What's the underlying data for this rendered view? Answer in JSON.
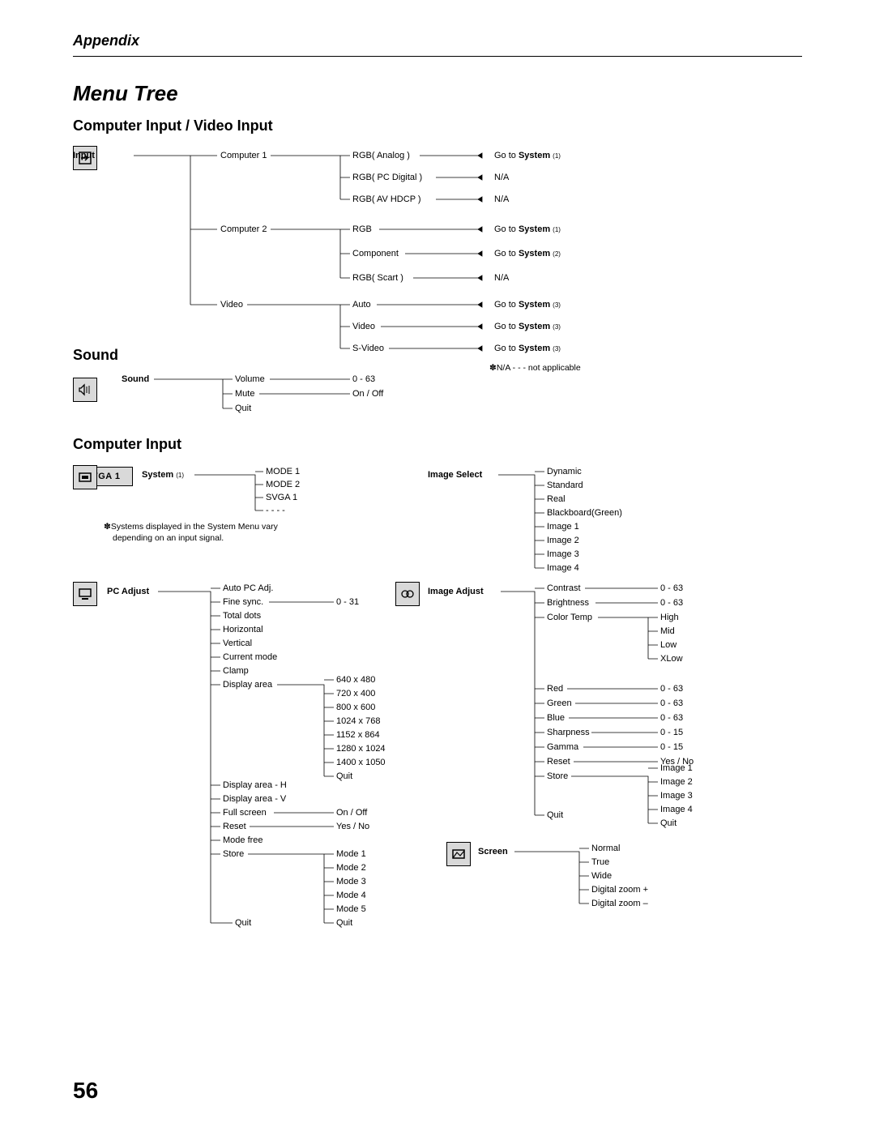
{
  "appendix": "Appendix",
  "title": "Menu Tree",
  "page_number": "56",
  "section_computer_video": "Computer Input / Video Input",
  "section_sound": "Sound",
  "section_computer_input": "Computer Input",
  "input": {
    "label": "Input",
    "computer1": {
      "label": "Computer 1",
      "opts": [
        {
          "name": "RGB( Analog )",
          "to": "Go to ",
          "sys": "System",
          "sysn": "(1)"
        },
        {
          "name": "RGB( PC Digital )",
          "to": "N/A"
        },
        {
          "name": "RGB( AV HDCP )",
          "to": "N/A"
        }
      ]
    },
    "computer2": {
      "label": "Computer 2",
      "opts": [
        {
          "name": "RGB",
          "to": "Go to ",
          "sys": "System",
          "sysn": "(1)"
        },
        {
          "name": "Component",
          "to": "Go to ",
          "sys": "System",
          "sysn": "(2)"
        },
        {
          "name": "RGB( Scart )",
          "to": "N/A"
        }
      ]
    },
    "video": {
      "label": "Video",
      "opts": [
        {
          "name": "Auto",
          "to": "Go to ",
          "sys": "System",
          "sysn": "(3)"
        },
        {
          "name": "Video",
          "to": "Go to ",
          "sys": "System",
          "sysn": "(3)"
        },
        {
          "name": "S-Video",
          "to": "Go to ",
          "sys": "System",
          "sysn": "(3)"
        }
      ]
    },
    "na_note_prefix": "✽",
    "na_note": "N/A - - - not applicable"
  },
  "sound": {
    "label": "Sound",
    "items": [
      {
        "name": "Volume",
        "val": "0 - 63"
      },
      {
        "name": "Mute",
        "val": "On / Off"
      },
      {
        "name": "Quit"
      }
    ]
  },
  "system": {
    "label": "System",
    "num": "(1)",
    "svga": "SVGA 1",
    "items": [
      "MODE 1",
      "MODE 2",
      "SVGA 1",
      "- - - -"
    ],
    "note_prefix": "✽",
    "note_line1": "Systems displayed in the System Menu vary",
    "note_line2": "depending on an input signal."
  },
  "image_select": {
    "label": "Image Select",
    "items": [
      "Dynamic",
      "Standard",
      "Real",
      "Blackboard(Green)",
      "Image 1",
      "Image 2",
      "Image 3",
      "Image 4"
    ]
  },
  "pc_adjust": {
    "label": "PC Adjust",
    "items": [
      {
        "name": "Auto PC Adj."
      },
      {
        "name": "Fine sync.",
        "val": "0 - 31"
      },
      {
        "name": "Total dots"
      },
      {
        "name": "Horizontal"
      },
      {
        "name": "Vertical"
      },
      {
        "name": "Current mode"
      },
      {
        "name": "Clamp"
      },
      {
        "name": "Display area"
      },
      {
        "name": "Display area - H"
      },
      {
        "name": "Display area - V"
      },
      {
        "name": "Full screen",
        "val": "On / Off"
      },
      {
        "name": "Reset",
        "val": "Yes / No"
      },
      {
        "name": "Mode free"
      },
      {
        "name": "Store"
      },
      {
        "name": "Quit"
      }
    ],
    "display_area_sub": [
      "640 x 480",
      "720 x 400",
      "800 x 600",
      "1024 x 768",
      "1152 x 864",
      "1280 x 1024",
      "1400 x 1050",
      "Quit"
    ],
    "store_sub": [
      "Mode 1",
      "Mode 2",
      "Mode 3",
      "Mode 4",
      "Mode 5",
      "Quit"
    ]
  },
  "image_adjust": {
    "label": "Image Adjust",
    "items": [
      {
        "name": "Contrast",
        "val": "0 - 63"
      },
      {
        "name": "Brightness",
        "val": "0 - 63"
      },
      {
        "name": "Color Temp"
      },
      {
        "name": "Red",
        "val": "0 - 63"
      },
      {
        "name": "Green",
        "val": "0 - 63"
      },
      {
        "name": "Blue",
        "val": "0 - 63"
      },
      {
        "name": "Sharpness",
        "val": "0 - 15"
      },
      {
        "name": "Gamma",
        "val": "0 - 15"
      },
      {
        "name": "Reset",
        "val": "Yes / No"
      },
      {
        "name": "Store"
      },
      {
        "name": "Quit"
      }
    ],
    "color_temp_sub": [
      "High",
      "Mid",
      "Low",
      "XLow"
    ],
    "store_sub": [
      "Image 1",
      "Image 2",
      "Image 3",
      "Image 4",
      "Quit"
    ]
  },
  "screen": {
    "label": "Screen",
    "items": [
      "Normal",
      "True",
      "Wide",
      "Digital zoom +",
      "Digital zoom –"
    ]
  }
}
